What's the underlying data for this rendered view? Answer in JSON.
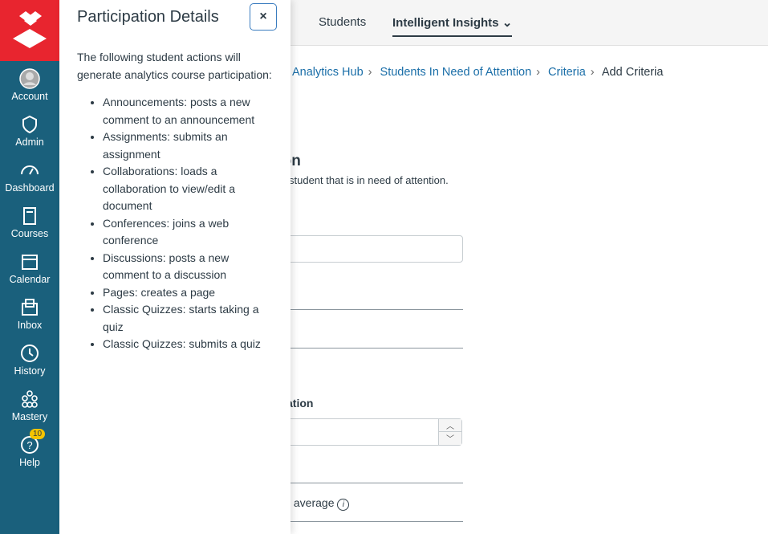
{
  "nav": {
    "items": [
      {
        "label": "Account",
        "icon": "avatar-icon"
      },
      {
        "label": "Admin",
        "icon": "shield-icon"
      },
      {
        "label": "Dashboard",
        "icon": "speedometer-icon"
      },
      {
        "label": "Courses",
        "icon": "book-icon"
      },
      {
        "label": "Calendar",
        "icon": "calendar-icon"
      },
      {
        "label": "Inbox",
        "icon": "inbox-icon"
      },
      {
        "label": "History",
        "icon": "clock-icon"
      },
      {
        "label": "Mastery",
        "icon": "mastery-icon"
      },
      {
        "label": "Help",
        "icon": "help-icon",
        "badge": "10"
      }
    ],
    "colors": {
      "bg": "#1a607c",
      "logo": "#e8252f"
    }
  },
  "tabs": {
    "students": "Students",
    "insights": "Intelligent Insights"
  },
  "breadcrumb": [
    "Analytics Hub",
    "Students In Need of Attention",
    "Criteria",
    "Add Criteria"
  ],
  "main": {
    "heading_fragment": "tion",
    "desc_fragment": "student that is in need of attention.",
    "participation_fragment": "ation",
    "class_avg_fragment": "ss average"
  },
  "tray": {
    "title": "Participation Details",
    "close": "×",
    "intro": "The following student actions will generate analytics course participation:",
    "items": [
      "Announcements: posts a new comment to an announcement",
      "Assignments: submits an assignment",
      "Collaborations: loads a collaboration to view/edit a document",
      "Conferences: joins a web conference",
      "Discussions: posts a new comment to a discussion",
      "Pages: creates a page",
      "Classic Quizzes: starts taking a quiz",
      "Classic Quizzes: submits a quiz"
    ]
  }
}
